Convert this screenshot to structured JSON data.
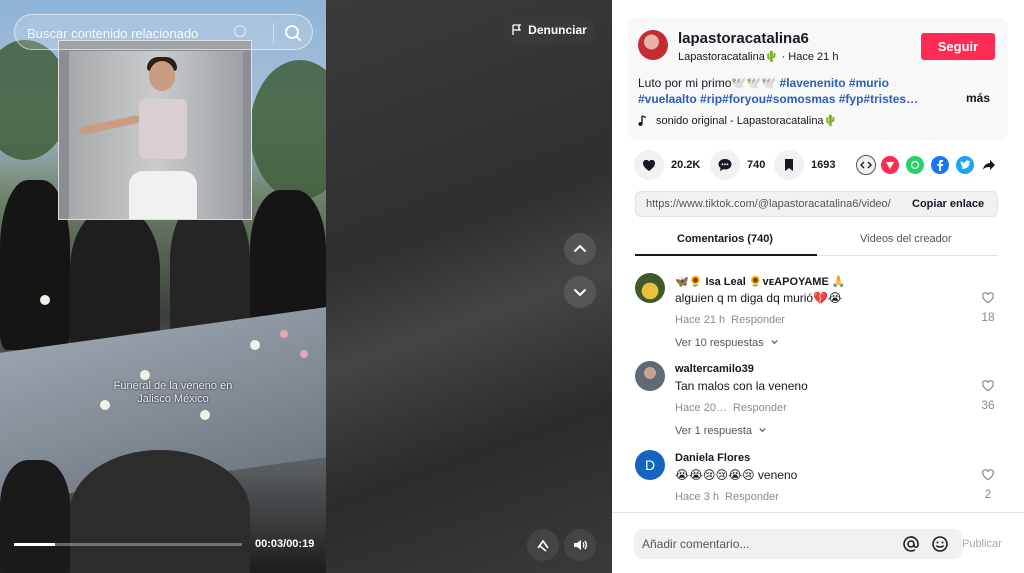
{
  "video": {
    "search_placeholder": "Buscar contenido relacionado",
    "report_label": "Denunciar",
    "caption_overlay": "Funeral de la veneno en Jalisco México",
    "time": "00:03/00:19",
    "progress_fraction": 0.18
  },
  "post": {
    "author_name": "lapastoracatalina6",
    "author_sub": "Lapastoracatalina🌵 · Hace 21 h",
    "follow_label": "Seguir",
    "description_text": "Luto por mi primo🕊️🕊️🕊️ ",
    "hashtags_line1": "#lavenenito #murio",
    "hashtags_line2": "#vuelaalto #rip#foryou#somosmas #fyp#tristes…",
    "more_label": "más",
    "music": "sonido original - Lapastoracatalina🌵"
  },
  "stats": {
    "likes": "20.2K",
    "comments": "740",
    "saves": "1693"
  },
  "share": {
    "link": "https://www.tiktok.com/@lapastoracatalina6/video/",
    "copy_label": "Copiar enlace",
    "icons": [
      "embed-icon",
      "send-icon",
      "whatsapp-icon",
      "facebook-icon",
      "twitter-icon",
      "share-arrow-icon"
    ]
  },
  "tabs": {
    "comments": "Comentarios (740)",
    "creator": "Videos del creador"
  },
  "comments": [
    {
      "user": "🦋🌻 Isa Leal 🌻ᴠᴇAPOYAME 🙏",
      "text": "alguien q m diga dq murió💔😭",
      "time": "Hace 21 h",
      "reply_label": "Responder",
      "replies": "Ver 10 respuestas",
      "likes": "18"
    },
    {
      "user": "waltercamilo39",
      "text": "Tan malos con la veneno",
      "time": "Hace 20…",
      "reply_label": "Responder",
      "replies": "Ver 1 respuesta",
      "likes": "36"
    },
    {
      "user": "Daniela Flores",
      "text": "😭😭😢😢😭😢 veneno",
      "time": "Hace 3 h",
      "reply_label": "Responder",
      "avatar_letter": "D",
      "likes": "2"
    }
  ],
  "composer": {
    "placeholder": "Añadir comentario...",
    "post_label": "Publicar"
  },
  "colors": {
    "accent": "#fe2c55",
    "hashtag": "#2b5db9"
  }
}
